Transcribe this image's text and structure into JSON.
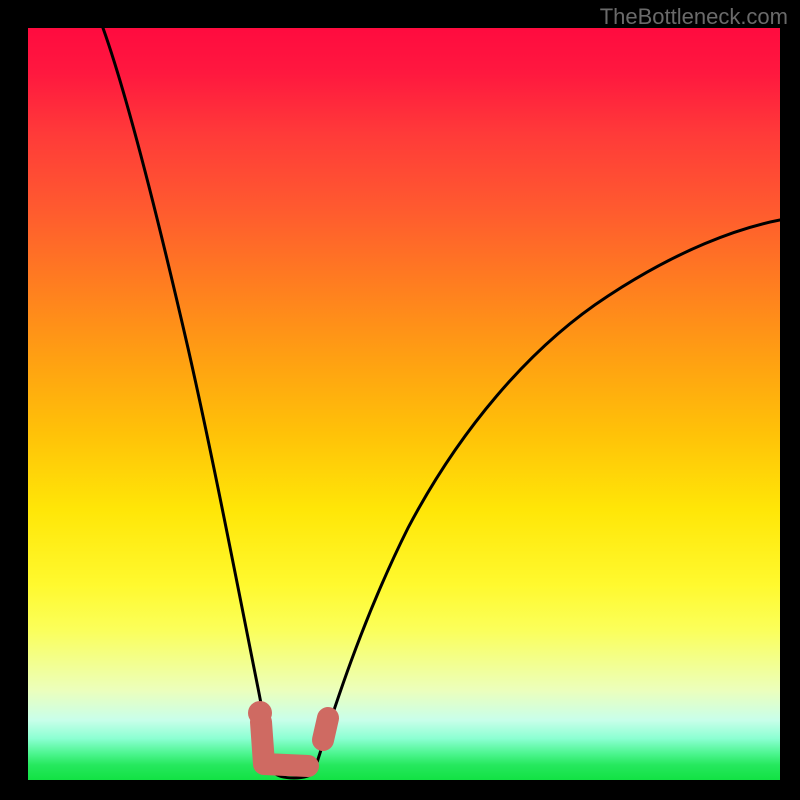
{
  "watermark": "TheBottleneck.com",
  "chart_data": {
    "type": "line",
    "title": "",
    "xlabel": "",
    "ylabel": "",
    "xlim": [
      0,
      100
    ],
    "ylim": [
      0,
      100
    ],
    "grid": false,
    "legend": false,
    "background": "rainbow-gradient-vertical",
    "series": [
      {
        "name": "left-branch",
        "x": [
          10,
          12,
          15,
          18,
          21,
          24,
          27,
          29,
          30.5,
          32
        ],
        "values": [
          100,
          86,
          70,
          54,
          40,
          27,
          15,
          7,
          2,
          0
        ]
      },
      {
        "name": "right-branch",
        "x": [
          36,
          38,
          42,
          48,
          55,
          63,
          72,
          82,
          92,
          100
        ],
        "values": [
          0,
          6,
          16,
          30,
          42,
          52,
          60,
          66,
          71,
          74
        ]
      }
    ],
    "markers": [
      {
        "name": "valley-marker",
        "shape": "L",
        "color": "#cf6a62",
        "points_xy": [
          [
            30.5,
            8
          ],
          [
            30.5,
            0.5
          ],
          [
            36,
            0.5
          ]
        ]
      },
      {
        "name": "valley-dot",
        "shape": "dot",
        "color": "#cf6a62",
        "xy": [
          30.5,
          9
        ]
      },
      {
        "name": "right-tick-marker",
        "shape": "segment",
        "color": "#cf6a62",
        "points_xy": [
          [
            38,
            6
          ],
          [
            39,
            9
          ]
        ]
      }
    ],
    "gradient_stops": [
      {
        "pos": 0,
        "color": "#ff0b3f"
      },
      {
        "pos": 50,
        "color": "#ffb800"
      },
      {
        "pos": 75,
        "color": "#fff92e"
      },
      {
        "pos": 100,
        "color": "#12e243"
      }
    ]
  }
}
